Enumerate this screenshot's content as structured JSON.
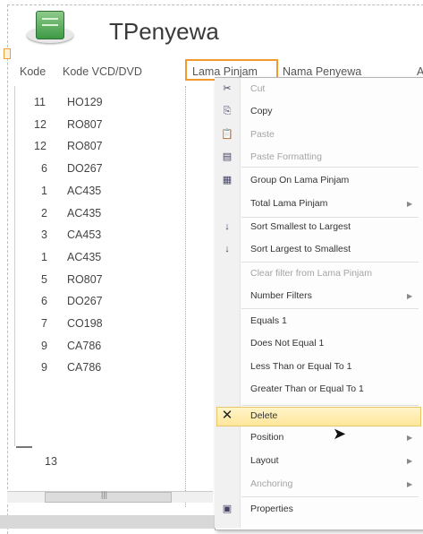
{
  "report": {
    "title": "TPenyewa"
  },
  "headers": [
    "Kode",
    "Kode VCD/DVD",
    "Lama Pinjam",
    "Nama Penyewa",
    "A"
  ],
  "rows": [
    {
      "kode": "11",
      "vcd": "HO129"
    },
    {
      "kode": "12",
      "vcd": "RO807"
    },
    {
      "kode": "12",
      "vcd": "RO807"
    },
    {
      "kode": "6",
      "vcd": "DO267"
    },
    {
      "kode": "1",
      "vcd": "AC435"
    },
    {
      "kode": "2",
      "vcd": "AC435"
    },
    {
      "kode": "3",
      "vcd": "CA453"
    },
    {
      "kode": "1",
      "vcd": "AC435"
    },
    {
      "kode": "5",
      "vcd": "RO807"
    },
    {
      "kode": "6",
      "vcd": "DO267"
    },
    {
      "kode": "7",
      "vcd": "CO198"
    },
    {
      "kode": "9",
      "vcd": "CA786"
    },
    {
      "kode": "9",
      "vcd": "CA786"
    }
  ],
  "total": "13",
  "context_menu": {
    "items": [
      {
        "label": "Cut",
        "icon": "scissors-icon"
      },
      {
        "label": "Copy",
        "icon": "copy-icon"
      },
      {
        "label": "Paste",
        "icon": "paste-icon"
      },
      {
        "label": "Paste Formatting",
        "icon": "paste-formatting-icon"
      },
      {
        "label": "Group On Lama Pinjam",
        "icon": "group-icon"
      },
      {
        "label": "Total Lama Pinjam"
      },
      {
        "label": "Sort Smallest to Largest",
        "icon": "sort-asc-icon"
      },
      {
        "label": "Sort Largest to Smallest",
        "icon": "sort-desc-icon"
      },
      {
        "label": "Clear filter from Lama Pinjam"
      },
      {
        "label": "Number Filters"
      },
      {
        "label": "Equals 1"
      },
      {
        "label": "Does Not Equal 1"
      },
      {
        "label": "Less Than or Equal To 1"
      },
      {
        "label": "Greater Than or Equal To 1"
      },
      {
        "label": "Delete",
        "icon": "delete-x-icon"
      },
      {
        "label": "Position"
      },
      {
        "label": "Layout"
      },
      {
        "label": "Anchoring"
      },
      {
        "label": "Properties",
        "icon": "properties-icon"
      }
    ]
  },
  "icons": {
    "report": "report-icon",
    "submenu": "chevron-right-icon",
    "cursor": "mouse-pointer-icon",
    "scroll_grip": "|||"
  }
}
